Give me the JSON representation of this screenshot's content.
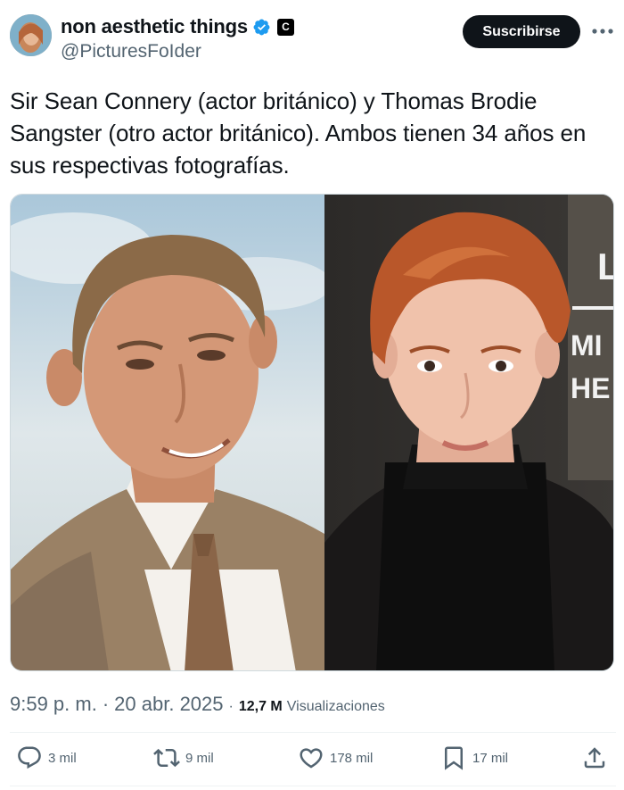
{
  "author": {
    "display_name": "non aesthetic things",
    "handle": "@PicturesFoIder",
    "affiliate_badge": "C"
  },
  "header": {
    "subscribe_label": "Suscribirse"
  },
  "tweet": {
    "text": "Sir Sean Connery (actor británico) y Thomas Brodie Sangster (otro actor británico). Ambos tienen 34 años en sus respectivas fotografías."
  },
  "photo": {
    "background_letters": [
      "L",
      "MI",
      "HE"
    ]
  },
  "meta": {
    "time": "9:59 p. m.",
    "separator": "·",
    "date": "20 abr. 2025",
    "views_count": "12,7 M",
    "views_label": "Visualizaciones"
  },
  "actions": {
    "replies": "3 mil",
    "reposts": "9 mil",
    "likes": "178 mil",
    "bookmarks": "17 mil"
  },
  "icons": [
    "verified-icon",
    "more-icon",
    "reply-icon",
    "repost-icon",
    "like-icon",
    "bookmark-icon",
    "share-icon"
  ],
  "colors": {
    "verified": "#1d9bf0",
    "subscribe_bg": "#0f1419",
    "secondary_text": "#536471"
  }
}
